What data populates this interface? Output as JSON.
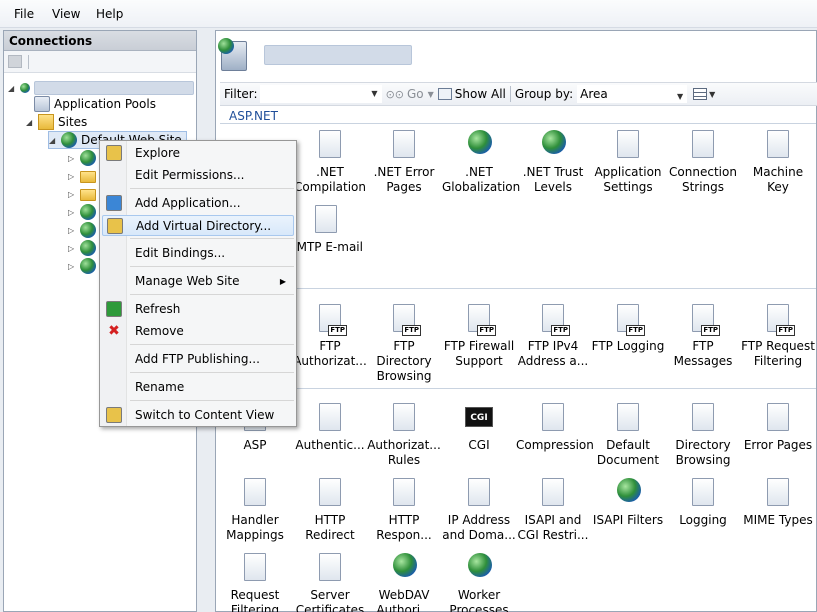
{
  "menu": {
    "file": "File",
    "view": "View",
    "help": "Help"
  },
  "connections": {
    "header": "Connections",
    "tree": {
      "app_pools": "Application Pools",
      "sites": "Sites",
      "default_site": "Default Web Site"
    }
  },
  "filterbar": {
    "filter_label": "Filter:",
    "go": "Go",
    "show_all": "Show All",
    "group_by_label": "Group by:",
    "group_by_value": "Area"
  },
  "sections": {
    "aspnet": "ASP.NET"
  },
  "features_aspnet": [
    {
      "label": ".NET Compilation",
      "icon": "compilation-icon"
    },
    {
      "label": ".NET Error Pages",
      "icon": "error-404-icon"
    },
    {
      "label": ".NET Globalization",
      "icon": "globe-icon"
    },
    {
      "label": ".NET Trust Levels",
      "icon": "trust-globe-icon"
    },
    {
      "label": "Application Settings",
      "icon": "settings-list-icon"
    },
    {
      "label": "Connection Strings",
      "icon": "database-icon"
    },
    {
      "label": "Machine Key",
      "icon": "key-icon"
    },
    {
      "label": "SMTP E-mail",
      "icon": "email-icon"
    }
  ],
  "features_ftp": [
    {
      "label": "FTP Authorizat...",
      "icon": "ftp-authorization-icon"
    },
    {
      "label": "FTP Directory Browsing",
      "icon": "ftp-directory-icon"
    },
    {
      "label": "FTP Firewall Support",
      "icon": "ftp-firewall-icon"
    },
    {
      "label": "FTP IPv4 Address a...",
      "icon": "ftp-ipv4-icon"
    },
    {
      "label": "FTP Logging",
      "icon": "ftp-logging-icon"
    },
    {
      "label": "FTP Messages",
      "icon": "ftp-messages-icon"
    },
    {
      "label": "FTP Request Filtering",
      "icon": "ftp-request-icon"
    }
  ],
  "features_iis": [
    {
      "label": "ASP",
      "icon": "asp-icon"
    },
    {
      "label": "Authentic...",
      "icon": "authentication-icon"
    },
    {
      "label": "Authorizat... Rules",
      "icon": "authorization-icon"
    },
    {
      "label": "CGI",
      "icon": "cgi-icon",
      "text": "CGI"
    },
    {
      "label": "Compression",
      "icon": "compression-icon"
    },
    {
      "label": "Default Document",
      "icon": "default-document-icon"
    },
    {
      "label": "Directory Browsing",
      "icon": "directory-browsing-icon"
    },
    {
      "label": "Error Pages",
      "icon": "error-pages-icon"
    },
    {
      "label": "Handler Mappings",
      "icon": "handler-icon"
    },
    {
      "label": "HTTP Redirect",
      "icon": "redirect-icon"
    },
    {
      "label": "HTTP Respon...",
      "icon": "http-response-icon"
    },
    {
      "label": "IP Address and Doma...",
      "icon": "ip-address-icon"
    },
    {
      "label": "ISAPI and CGI Restri...",
      "icon": "isapi-cgi-icon"
    },
    {
      "label": "ISAPI Filters",
      "icon": "isapi-filters-icon"
    },
    {
      "label": "Logging",
      "icon": "logging-icon"
    },
    {
      "label": "MIME Types",
      "icon": "mime-icon"
    },
    {
      "label": "Request Filtering",
      "icon": "request-filtering-icon"
    },
    {
      "label": "Server Certificates",
      "icon": "certificate-icon"
    },
    {
      "label": "WebDAV Authori...",
      "icon": "webdav-icon"
    },
    {
      "label": "Worker Processes",
      "icon": "worker-icon"
    }
  ],
  "context_menu": [
    {
      "label": "Explore",
      "icon": "explore-icon"
    },
    {
      "label": "Edit Permissions...",
      "icon": ""
    },
    {
      "label": "Add Application...",
      "icon": "add-application-icon"
    },
    {
      "label": "Add Virtual Directory...",
      "icon": "add-virtual-directory-icon"
    },
    {
      "label": "Edit Bindings...",
      "icon": ""
    },
    {
      "label": "Manage Web Site",
      "icon": ""
    },
    {
      "label": "Refresh",
      "icon": "refresh-icon"
    },
    {
      "label": "Remove",
      "icon": "remove-icon"
    },
    {
      "label": "Add FTP Publishing...",
      "icon": ""
    },
    {
      "label": "Rename",
      "icon": ""
    },
    {
      "label": "Switch to Content View",
      "icon": "content-view-icon"
    }
  ],
  "colors": {
    "section_heading": "#1f4e99",
    "highlight": "#d8e8fa",
    "remove": "#d42020",
    "refresh": "#2e9a3a"
  }
}
